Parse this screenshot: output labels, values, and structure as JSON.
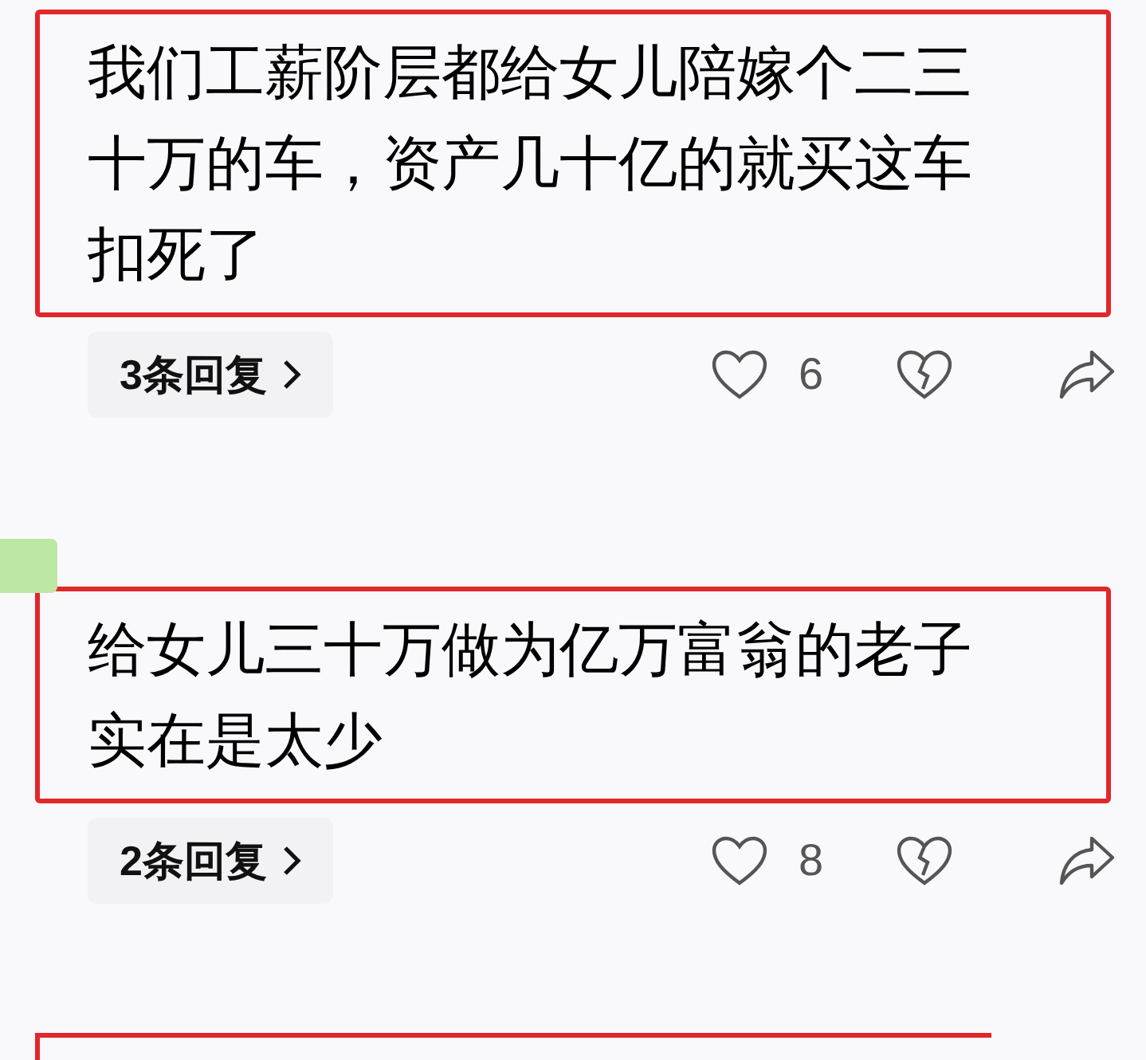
{
  "comments": [
    {
      "lines": [
        "我们工薪阶层都给女儿陪嫁个二三",
        "十万的车，资产几十亿的就买这车",
        "扣死了"
      ],
      "replies": "3条回复",
      "likes": "6"
    },
    {
      "lines": [
        "给女儿三十万做为亿万富翁的老子",
        "实在是太少"
      ],
      "replies": "2条回复",
      "likes": "8"
    }
  ]
}
